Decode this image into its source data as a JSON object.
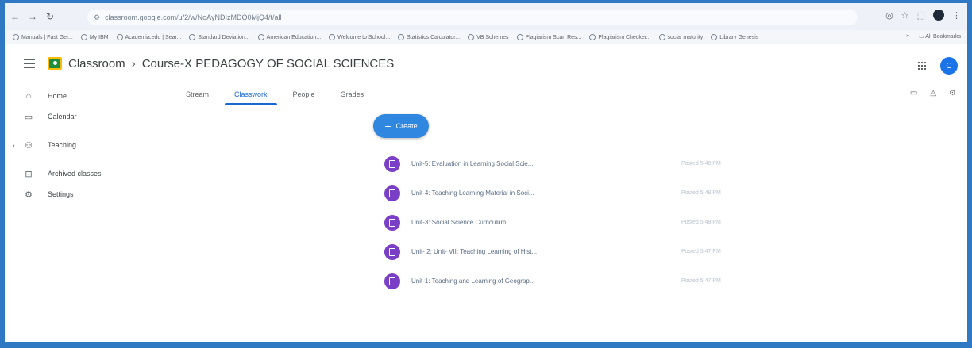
{
  "browser": {
    "url": "classroom.google.com/u/2/w/NoAyNDIzMDQ0MjQ4/t/all",
    "bookmarks": [
      "Manuals | Fast Ger...",
      "My IBM",
      "Academia.edu | Sear...",
      "Standard Deviation...",
      "American Education...",
      "Welcome to School...",
      "Statistics Calculator...",
      "VB Schemes",
      "Plagiarism Scan Res...",
      "Plagiarism Checker...",
      "social maturity",
      "Library Genesis"
    ],
    "all_bookmarks": "All Bookmarks"
  },
  "header": {
    "app_name": "Classroom",
    "course_title": "Course-X PEDAGOGY OF SOCIAL SCIENCES",
    "avatar_initial": "C"
  },
  "sidebar": {
    "items": [
      {
        "label": "Home",
        "icon": "home-icon"
      },
      {
        "label": "Calendar",
        "icon": "calendar-icon"
      },
      {
        "label": "Teaching",
        "icon": "people-icon"
      },
      {
        "label": "Archived classes",
        "icon": "archive-icon"
      },
      {
        "label": "Settings",
        "icon": "gear-icon"
      }
    ]
  },
  "tabs": [
    "Stream",
    "Classwork",
    "People",
    "Grades"
  ],
  "active_tab": "Classwork",
  "create_label": "Create",
  "topics": [
    {
      "title": "Unit-5: Evaluation in Learning Social Scie...",
      "date": "Posted 5:48 PM"
    },
    {
      "title": "Unit-4: Teaching Learning Material in Soci...",
      "date": "Posted 5:48 PM"
    },
    {
      "title": "Unit-3: Social Science Curriculum",
      "date": "Posted 5:48 PM"
    },
    {
      "title": "Unit- 2: Unit- VII: Teaching Learning of Hist...",
      "date": "Posted 5:47 PM"
    },
    {
      "title": "Unit-1: Teaching and Learning of Geograp...",
      "date": "Posted 5:47 PM"
    }
  ],
  "colors": {
    "accent": "#1967d2",
    "create_button": "#2f87e0",
    "topic_icon": "#7b3fc7",
    "frame": "#2f78c4"
  }
}
